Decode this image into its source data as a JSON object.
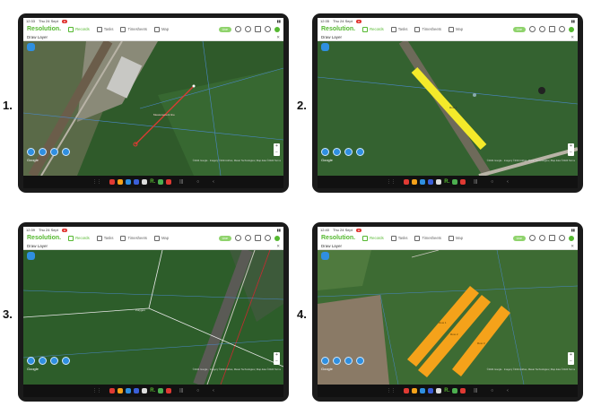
{
  "figure_labels": [
    "1.",
    "2.",
    "3.",
    "4."
  ],
  "app": {
    "logo": "Resolution.",
    "nav": [
      {
        "label": "Records",
        "icon": "records-icon",
        "active": true
      },
      {
        "label": "Tasks",
        "icon": "tasks-icon",
        "active": false
      },
      {
        "label": "Timesheets",
        "icon": "timesheets-icon",
        "active": false
      },
      {
        "label": "Map",
        "icon": "map-icon",
        "active": false
      }
    ],
    "sync_pill": "Live",
    "layer_title": "Draw Layer",
    "close_glyph": "✕",
    "google_label": "Google",
    "attribution": "©2024 Google · Imagery ©2024 Airbus, Maxar Technologies | Map data ©2024 Terms",
    "zoom": [
      "+",
      "−"
    ]
  },
  "screens": [
    {
      "id": "1",
      "status_time": "12:33",
      "status_date": "Thu 24 Sept",
      "map_label": "Measurement line"
    },
    {
      "id": "2",
      "status_time": "12:35",
      "status_date": "Thu 24 Sept",
      "map_label": "Row 1"
    },
    {
      "id": "3",
      "status_time": "12:39",
      "status_date": "Thu 24 Sept",
      "map_label": "Polygon"
    },
    {
      "id": "4",
      "status_time": "12:40",
      "status_date": "Thu 24 Sept",
      "map_labels": [
        "Row 1",
        "Row 2",
        "Row 3"
      ]
    }
  ],
  "colors": {
    "accent": "#55b830",
    "button": "#2f8fe0",
    "yellow": "#f4ea2a",
    "orange": "#f5a21a",
    "red": "#e03a33"
  }
}
